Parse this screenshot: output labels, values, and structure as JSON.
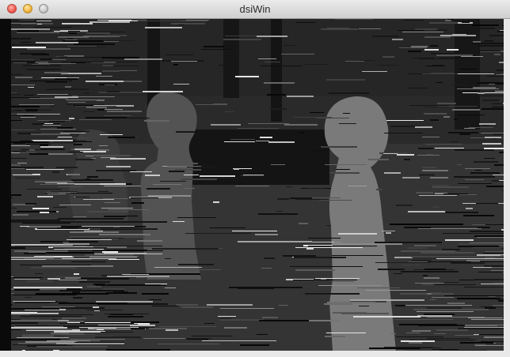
{
  "window": {
    "title": "dsiWin",
    "controls": {
      "close": "close-button",
      "minimize": "minimize-button",
      "zoom": "zoom-button"
    }
  },
  "canvas": {
    "image": "disparity-depth-map",
    "colors": {
      "background": "#1d1d1d",
      "person_right": "#7a7a7a",
      "person_left": "#555555",
      "floor": "#3a3a3a",
      "streak_light": "#bdbdbd",
      "streak_dark": "#0c0c0c"
    }
  }
}
